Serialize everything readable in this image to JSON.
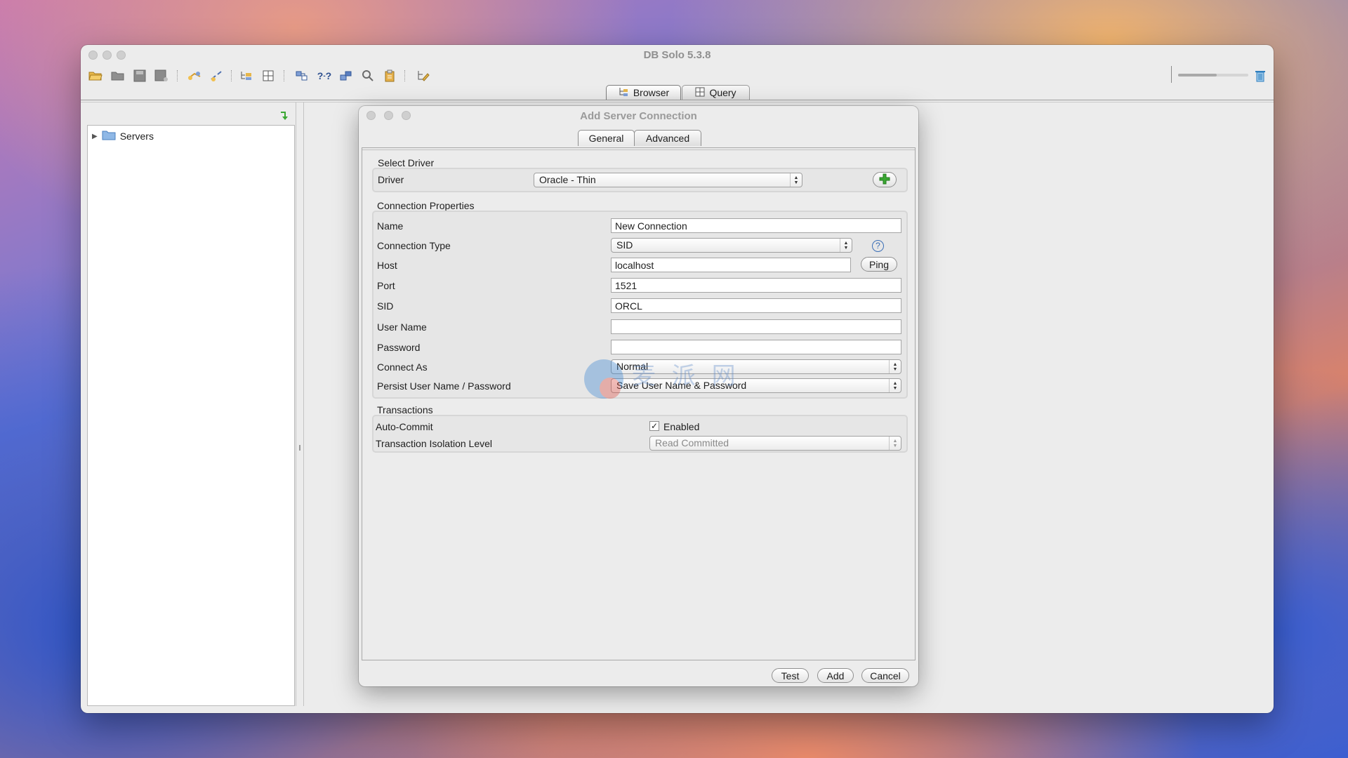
{
  "window": {
    "title": "DB Solo  5.3.8"
  },
  "main_tabs": [
    {
      "label": "Browser",
      "icon": "tree-icon"
    },
    {
      "label": "Query",
      "icon": "grid-icon"
    }
  ],
  "tree": {
    "root_label": "Servers",
    "root_icon": "folder-icon"
  },
  "dialog": {
    "title": "Add Server Connection",
    "tabs": [
      "General",
      "Advanced"
    ],
    "select_driver": {
      "title": "Select Driver",
      "driver_label": "Driver",
      "driver_value": "Oracle - Thin"
    },
    "connection_properties": {
      "title": "Connection Properties",
      "name_label": "Name",
      "name_value": "New Connection",
      "conn_type_label": "Connection Type",
      "conn_type_value": "SID",
      "host_label": "Host",
      "host_value": "localhost",
      "ping_label": "Ping",
      "port_label": "Port",
      "port_value": "1521",
      "sid_label": "SID",
      "sid_value": "ORCL",
      "username_label": "User Name",
      "username_value": "",
      "password_label": "Password",
      "password_value": "",
      "connect_as_label": "Connect As",
      "connect_as_value": "Normal",
      "persist_label": "Persist User Name / Password",
      "persist_value": "Save User Name & Password"
    },
    "transactions": {
      "title": "Transactions",
      "autocommit_label": "Auto-Commit",
      "autocommit_checked": true,
      "autocommit_text": "Enabled",
      "isolation_label": "Transaction Isolation Level",
      "isolation_value": "Read Committed"
    },
    "buttons": {
      "test": "Test",
      "add": "Add",
      "cancel": "Cancel"
    }
  },
  "watermark": {
    "text": "麦 派 网"
  },
  "colors": {
    "accent_green": "#3aa832",
    "help_blue": "#3b6fb6",
    "trash_blue": "#2f7fbf"
  }
}
